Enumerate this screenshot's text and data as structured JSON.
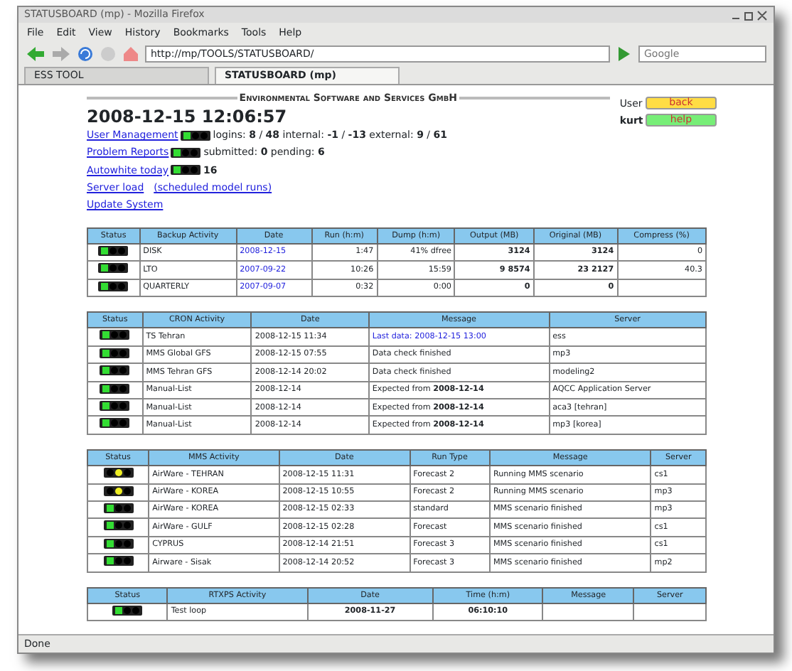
{
  "window": {
    "title": "STATUSBOARD (mp) - Mozilla Firefox"
  },
  "menu": [
    "File",
    "Edit",
    "View",
    "History",
    "Bookmarks",
    "Tools",
    "Help"
  ],
  "address": "http://mp/TOOLS/STATUSBOARD/",
  "search": {
    "placeholder": "Google"
  },
  "tabs": [
    {
      "label": "ESS TOOL",
      "selected": false
    },
    {
      "label": "STATUSBOARD (mp)",
      "selected": true
    }
  ],
  "company": "Environmental Software and Services GmbH",
  "user": {
    "label": "User",
    "name": "kurt"
  },
  "buttons": [
    {
      "label": "back",
      "color": "#ffdd44"
    },
    {
      "label": "help",
      "color": "#77ee77"
    }
  ],
  "datetime": "2008-12-15 12:06:57",
  "summary": [
    {
      "link": "User Management",
      "color": "#33dd33",
      "text": "logins: **8** / **48** internal: **-1** / **-13** external: **9** / **61**"
    },
    {
      "link": "Problem Reports",
      "color": "#33dd33",
      "text": "submitted: **0** pending: **6**"
    },
    {
      "link": "Autowhite today",
      "color": "#33dd33",
      "text": "**16**"
    }
  ],
  "links": [
    [
      "Server load",
      "(scheduled model runs)"
    ],
    [
      "Update System"
    ]
  ],
  "tables": [
    {
      "columns": [
        {
          "label": "Status"
        },
        {
          "label": "Backup Activity"
        },
        {
          "label": "Date"
        },
        {
          "label": "Run (h:m)"
        },
        {
          "label": "Dump (h:m)"
        },
        {
          "label": "Output (MB)"
        },
        {
          "label": "Original (MB)"
        },
        {
          "label": "Compress (%)"
        }
      ],
      "rows": [
        {
          "cells": [
            {
              "kind": "light",
              "color": "#33dd33"
            },
            {
              "text": "DISK"
            },
            {
              "text": "2008-12-15",
              "kind": "link"
            },
            {
              "text": "1:47",
              "kind": "number"
            },
            {
              "text": "41% dfree",
              "kind": "number"
            },
            {
              "text": "3124",
              "kind": "total"
            },
            {
              "text": "3124",
              "kind": "total"
            },
            {
              "text": "0",
              "kind": "number"
            }
          ]
        },
        {
          "cells": [
            {
              "kind": "light",
              "color": "#33dd33"
            },
            {
              "text": "LTO"
            },
            {
              "text": "2007-09-22",
              "kind": "link"
            },
            {
              "text": "10:26",
              "kind": "number"
            },
            {
              "text": "15:59",
              "kind": "number"
            },
            {
              "text": "9 8574",
              "kind": "total"
            },
            {
              "text": "23 2127",
              "kind": "total"
            },
            {
              "text": "40.3",
              "kind": "number"
            }
          ]
        },
        {
          "cells": [
            {
              "kind": "light",
              "color": "#33dd33"
            },
            {
              "text": "QUARTERLY"
            },
            {
              "text": "2007-09-07",
              "kind": "link"
            },
            {
              "text": "0:32",
              "kind": "number"
            },
            {
              "text": "0:00",
              "kind": "number"
            },
            {
              "text": "0",
              "kind": "total"
            },
            {
              "text": "0",
              "kind": "total"
            },
            {
              "text": ""
            }
          ]
        }
      ]
    },
    {
      "columns": [
        {
          "label": "Status"
        },
        {
          "label": "CRON Activity"
        },
        {
          "label": "Date"
        },
        {
          "label": "Message"
        },
        {
          "label": "Server"
        }
      ],
      "rows": [
        {
          "cells": [
            {
              "kind": "light",
              "color": "#33dd33"
            },
            {
              "text": "TS Tehran"
            },
            {
              "text": "2008-12-15 11:34"
            },
            {
              "text": "Last data: 2008-12-15 13:00",
              "kind": "link"
            },
            {
              "text": "ess"
            }
          ]
        },
        {
          "cells": [
            {
              "kind": "light",
              "color": "#33dd33"
            },
            {
              "text": "MMS Global GFS"
            },
            {
              "text": "2008-12-15 07:55"
            },
            {
              "text": "Data check finished"
            },
            {
              "text": "mp3"
            }
          ]
        },
        {
          "cells": [
            {
              "kind": "light",
              "color": "#33dd33"
            },
            {
              "text": "MMS Tehran GFS"
            },
            {
              "text": "2008-12-14 20:02"
            },
            {
              "text": "Data check finished"
            },
            {
              "text": "modeling2"
            }
          ]
        },
        {
          "cells": [
            {
              "kind": "light",
              "color": "#33dd33"
            },
            {
              "text": "Manual-List"
            },
            {
              "text": "2008-12-14"
            },
            {
              "text": "Expected from **2008-12-14**"
            },
            {
              "text": "AQCC Application Server"
            }
          ]
        },
        {
          "cells": [
            {
              "kind": "light",
              "color": "#33dd33"
            },
            {
              "text": "Manual-List"
            },
            {
              "text": "2008-12-14"
            },
            {
              "text": "Expected from **2008-12-14**"
            },
            {
              "text": "aca3 [tehran]"
            }
          ]
        },
        {
          "cells": [
            {
              "kind": "light",
              "color": "#33dd33"
            },
            {
              "text": "Manual-List"
            },
            {
              "text": "2008-12-14"
            },
            {
              "text": "Expected from **2008-12-14**"
            },
            {
              "text": "mp3 [korea]"
            }
          ]
        }
      ]
    },
    {
      "columns": [
        {
          "label": "Status"
        },
        {
          "label": "MMS Activity"
        },
        {
          "label": "Date"
        },
        {
          "label": "Run Type"
        },
        {
          "label": "Message"
        },
        {
          "label": "Server"
        }
      ],
      "rows": [
        {
          "cells": [
            {
              "kind": "light",
              "color": "#eeee22"
            },
            {
              "text": "AirWare - TEHRAN"
            },
            {
              "text": "2008-12-15 11:31"
            },
            {
              "text": "Forecast 2"
            },
            {
              "text": "Running MMS scenario"
            },
            {
              "text": "cs1"
            }
          ]
        },
        {
          "cells": [
            {
              "kind": "light",
              "color": "#eeee22"
            },
            {
              "text": "AirWare - KOREA"
            },
            {
              "text": "2008-12-15 10:55"
            },
            {
              "text": "Forecast 2"
            },
            {
              "text": "Running MMS scenario"
            },
            {
              "text": "mp3"
            }
          ]
        },
        {
          "cells": [
            {
              "kind": "light",
              "color": "#33dd33"
            },
            {
              "text": "AirWare - KOREA"
            },
            {
              "text": "2008-12-15 02:33"
            },
            {
              "text": "standard"
            },
            {
              "text": "MMS scenario finished"
            },
            {
              "text": "mp3"
            }
          ]
        },
        {
          "cells": [
            {
              "kind": "light",
              "color": "#33dd33"
            },
            {
              "text": "AirWare - GULF"
            },
            {
              "text": "2008-12-15 02:28"
            },
            {
              "text": "Forecast"
            },
            {
              "text": "MMS scenario finished"
            },
            {
              "text": "cs1"
            }
          ]
        },
        {
          "cells": [
            {
              "kind": "light",
              "color": "#33dd33"
            },
            {
              "text": "CYPRUS"
            },
            {
              "text": "2008-12-14 21:51"
            },
            {
              "text": "Forecast 3"
            },
            {
              "text": "MMS scenario finished"
            },
            {
              "text": "cs1"
            }
          ]
        },
        {
          "cells": [
            {
              "kind": "light",
              "color": "#33dd33"
            },
            {
              "text": "Airware - Sisak"
            },
            {
              "text": "2008-12-14 20:52"
            },
            {
              "text": "Forecast 3"
            },
            {
              "text": "MMS scenario finished"
            },
            {
              "text": "mp2"
            }
          ]
        }
      ]
    },
    {
      "columns": [
        {
          "label": "Status"
        },
        {
          "label": "RTXPS Activity"
        },
        {
          "label": "Date"
        },
        {
          "label": "Time (h:m)"
        },
        {
          "label": "Message"
        },
        {
          "label": "Server"
        }
      ],
      "rows": [
        {
          "cells": [
            {
              "kind": "light",
              "color": "#33dd33"
            },
            {
              "text": "Test loop"
            },
            {
              "text": "2008-11-27",
              "kind": "strong"
            },
            {
              "text": "06:10:10",
              "kind": "strong"
            },
            {
              "text": ""
            },
            {
              "text": ""
            }
          ]
        }
      ]
    }
  ],
  "status_bar": "Done"
}
